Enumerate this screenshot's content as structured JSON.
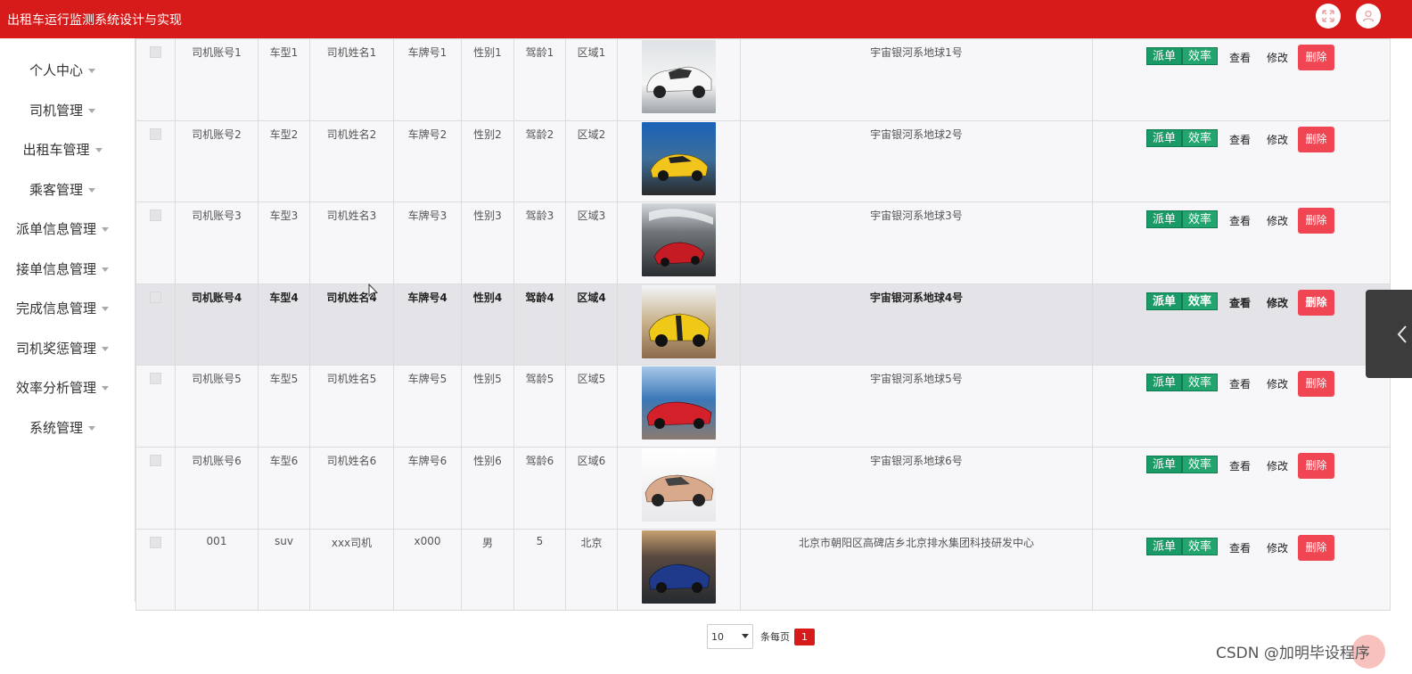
{
  "header": {
    "title": "出租车运行监测系统设计与实现",
    "icons": [
      "fullscreen-icon",
      "user-icon"
    ]
  },
  "sidebar": {
    "items": [
      {
        "label": "个人中心"
      },
      {
        "label": "司机管理"
      },
      {
        "label": "出租车管理"
      },
      {
        "label": "乘客管理"
      },
      {
        "label": "派单信息管理"
      },
      {
        "label": "接单信息管理"
      },
      {
        "label": "完成信息管理"
      },
      {
        "label": "司机奖惩管理"
      },
      {
        "label": "效率分析管理"
      },
      {
        "label": "系统管理"
      }
    ]
  },
  "actions": {
    "dispatch": "派单",
    "efficiency": "效率",
    "view": "查看",
    "edit": "修改",
    "delete": "删除"
  },
  "table": {
    "rows": [
      {
        "account": "司机账号1",
        "model": "车型1",
        "name": "司机姓名1",
        "plate": "车牌号1",
        "gender": "性别1",
        "age": "驾龄1",
        "area": "区域1",
        "address": "宇宙银河系地球1号",
        "img": "white-sports-car"
      },
      {
        "account": "司机账号2",
        "model": "车型2",
        "name": "司机姓名2",
        "plate": "车牌号2",
        "gender": "性别2",
        "age": "驾龄2",
        "area": "区域2",
        "address": "宇宙银河系地球2号",
        "img": "yellow-sports-car"
      },
      {
        "account": "司机账号3",
        "model": "车型3",
        "name": "司机姓名3",
        "plate": "车牌号3",
        "gender": "性别3",
        "age": "驾龄3",
        "area": "区域3",
        "address": "宇宙银河系地球3号",
        "img": "red-car-on-track"
      },
      {
        "account": "司机账号4",
        "model": "车型4",
        "name": "司机姓名4",
        "plate": "车牌号4",
        "gender": "性别4",
        "age": "驾龄4",
        "area": "区域4",
        "address": "宇宙银河系地球4号",
        "img": "yellow-muscle-car"
      },
      {
        "account": "司机账号5",
        "model": "车型5",
        "name": "司机姓名5",
        "plate": "车牌号5",
        "gender": "性别5",
        "age": "驾龄5",
        "area": "区域5",
        "address": "宇宙银河系地球5号",
        "img": "red-convertible"
      },
      {
        "account": "司机账号6",
        "model": "车型6",
        "name": "司机姓名6",
        "plate": "车牌号6",
        "gender": "性别6",
        "age": "驾龄6",
        "area": "区域6",
        "address": "宇宙银河系地球6号",
        "img": "tan-sports-car"
      },
      {
        "account": "001",
        "model": "suv",
        "name": "xxx司机",
        "plate": "x000",
        "gender": "男",
        "age": "5",
        "area": "北京",
        "address": "北京市朝阳区高碑店乡北京排水集团科技研发中心",
        "img": "blue-sports-car"
      }
    ]
  },
  "pagination": {
    "page_size": "10",
    "page_size_label": "条每页",
    "current_page": "1"
  },
  "watermark": "CSDN @加明毕设程序",
  "colors": {
    "header": "#d71b1b",
    "action_green": "#1a9a67",
    "delete_red": "#f04552"
  }
}
